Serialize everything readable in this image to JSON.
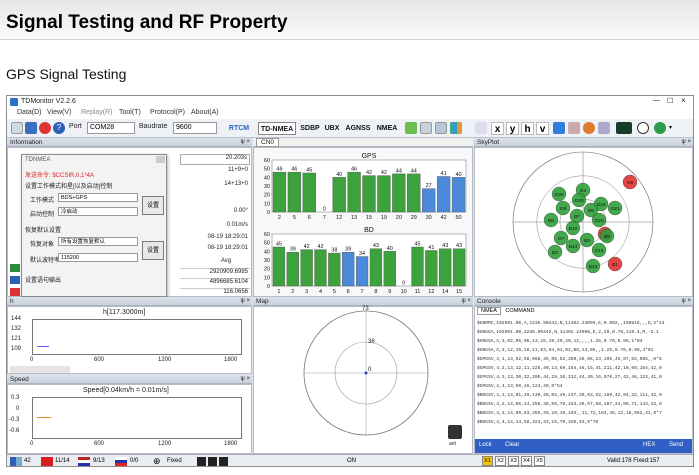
{
  "page": {
    "heading": "Signal Testing and RF Property",
    "subheading": "GPS Signal Testing"
  },
  "app": {
    "title": "TDMonitor V2.2.6",
    "menu": [
      "Data(D)",
      "View(V)",
      "Replay(R)",
      "Tool(T)",
      "Protocol(P)",
      "About(A)"
    ],
    "toolbar": {
      "port_label": "Port",
      "port_value": "COM28",
      "baud_label": "Baudrate",
      "baud_value": "9600",
      "tabs": [
        "RTCM Data",
        "TD-NMEA",
        "SDBP",
        "UBX",
        "AGNSS",
        "NMEA"
      ],
      "letters": [
        "x",
        "y",
        "h",
        "v"
      ]
    }
  },
  "information": {
    "title": "Information",
    "rows": [
      "20.203s",
      "11+9+0",
      "14+13+0",
      "0.00°",
      "0.01m/s",
      "08-19 18:29:01",
      "08-19 18:29:01"
    ],
    "avg_label": "Avg",
    "avg_values": [
      "2920909.6985",
      "4896685.6104",
      "116.0656"
    ]
  },
  "dialog": {
    "title": "TDNMEA",
    "red_line": "发送命令: $CCSIR,0,1*4A",
    "section1": "设置工作模式和星[以及启动]控制",
    "work_mode_label": "工作模式",
    "work_mode_value": "BDS+GPS",
    "start_label": "启动控制",
    "start_value": "冷启动",
    "set_btn": "设置",
    "section2": "恢复默认设置",
    "restore_label": "恢复对象",
    "restore_value": "所有设置恢复默认",
    "baud_label": "默认波特率",
    "baud_value": "115200",
    "set_btn2": "设置",
    "section3": "设置语句输出"
  },
  "h_panel": {
    "title": "h",
    "chart_title": "h[117.3000m]",
    "yticks": [
      "144",
      "132",
      "121",
      "109"
    ],
    "xticks": [
      "0",
      "600",
      "1200",
      "1800"
    ]
  },
  "speed_panel": {
    "title": "Speed",
    "chart_title": "Speed[0.04km/h = 0.01m/s]",
    "yticks": [
      "0.3",
      "0",
      "-0.3",
      "-0.6"
    ],
    "xticks": [
      "0",
      "600",
      "1200",
      "1800"
    ]
  },
  "cn0_panel": {
    "tab": "CN0"
  },
  "map_panel": {
    "title": "Map",
    "scale_top": "73",
    "scale_mid": "36",
    "scale_bottom": "0",
    "icon_label": "ant"
  },
  "skyplot_panel": {
    "title": "SkyPlot",
    "satellites": [
      {
        "id": "G5",
        "color": "#e03030"
      },
      {
        "id": "G2",
        "color": "#2fa03a"
      },
      {
        "id": "G30",
        "color": "#2fa03a"
      },
      {
        "id": "G40",
        "color": "#2fa03a"
      },
      {
        "id": "G29",
        "color": "#2fa03a"
      },
      {
        "id": "G21",
        "color": "#2fa03a"
      },
      {
        "id": "B5",
        "color": "#2fa03a"
      },
      {
        "id": "G8",
        "color": "#2fa03a"
      },
      {
        "id": "B7",
        "color": "#2fa03a"
      },
      {
        "id": "B6",
        "color": "#2fa03a"
      },
      {
        "id": "G20",
        "color": "#2fa03a"
      },
      {
        "id": "B10",
        "color": "#2fa03a"
      },
      {
        "id": "G7",
        "color": "#2fa03a"
      },
      {
        "id": "B9",
        "color": "#e03030"
      },
      {
        "id": "B2",
        "color": "#2fa03a"
      },
      {
        "id": "B14",
        "color": "#2fa03a"
      },
      {
        "id": "B3",
        "color": "#2fa03a"
      },
      {
        "id": "G15",
        "color": "#2fa03a"
      },
      {
        "id": "B1",
        "color": "#e03030"
      },
      {
        "id": "B13",
        "color": "#2fa03a"
      },
      {
        "id": "B8",
        "color": "#2fa03a"
      }
    ]
  },
  "console_panel": {
    "title": "Console",
    "tabs": [
      "NMEA",
      "COMMAND"
    ],
    "lines": [
      "$GNRMC,102901.00,A,2236.90442,N,11402.24096,E,0.002,,190816,,,D,V*14",
      "$GNGGA,102901.00,2236.90442,N,11402.24096,E,2,20,0.76,119.4,M,-2.1",
      "$GNGSA,A,3,02,05,06,13,15,19,29,20,12,,,,1.25,0.76,0.99,1*03",
      "$GNGSA,A,3,12,15,28,11,03,04,01,02,08,14,05,,1.25,0.76,0.99,4*01",
      "$GPGSV,4,1,13,02,58,068,46,05,52,359,46,06,23,105,45,07,02,085,,0*6",
      "$GPGSV,4,2,13,12,11,225,40,13,69,164,46,15,41,211,42,19,09,154,42,0",
      "$GPGSV,4,3,13,20,32,295,44,29,36,312,44,30,16,078,27,42,46,123,41,0",
      "$GPGSV,4,4,13,50,46,123,40,0*54",
      "$BDGSV,4,1,14,01,49,130,45,02,49,237,39,03,62,189,42,04,32,111,42,0",
      "$BDGSV,4,2,14,05,24,256,38,06,70,333,39,07,08,167,34,08,71,143,43,0",
      "$BDGSV,4,3,14,09,63,355,40,10,10,193,,11,72,184,45,12,18,052,41,0*7",
      "$BDGSV,4,4,14,14,58,323,43,15,70,320,43,0*70"
    ],
    "footer_buttons": [
      "Lock",
      "Clear",
      "HEX",
      "Send"
    ]
  },
  "status_bar": {
    "gps_count": "42",
    "cn_count": "11/14",
    "us_count": "9/13",
    "ru_count": "0/0",
    "fix_label": "Fixed",
    "rx_buttons": [
      "X1",
      "X2",
      "X3",
      "X4",
      "X5"
    ],
    "on_label": "ON",
    "valid_text": "Valid:178 Fixed:157"
  },
  "chart_data": [
    {
      "type": "bar",
      "title": "GPS",
      "categories": [
        "2",
        "5",
        "6",
        "7",
        "12",
        "13",
        "15",
        "19",
        "20",
        "29",
        "30",
        "42",
        "50"
      ],
      "values": [
        46,
        46,
        45,
        0,
        40,
        46,
        42,
        42,
        44,
        44,
        27,
        41,
        40
      ],
      "colors": [
        "#3ca23c",
        "#3ca23c",
        "#3ca23c",
        "#3ca23c",
        "#3ca23c",
        "#3ca23c",
        "#3ca23c",
        "#3ca23c",
        "#3ca23c",
        "#3ca23c",
        "#4a8ad8",
        "#4a8ad8",
        "#4a8ad8"
      ],
      "yticks": [
        0,
        10,
        20,
        30,
        40,
        50,
        60
      ],
      "ylim": [
        0,
        60
      ]
    },
    {
      "type": "bar",
      "title": "BD",
      "categories": [
        "1",
        "2",
        "3",
        "4",
        "5",
        "6",
        "7",
        "8",
        "9",
        "10",
        "11",
        "12",
        "14",
        "15"
      ],
      "values": [
        45,
        39,
        42,
        42,
        38,
        39,
        34,
        43,
        40,
        0,
        45,
        41,
        43,
        43
      ],
      "colors": [
        "#3ca23c",
        "#3ca23c",
        "#3ca23c",
        "#3ca23c",
        "#3ca23c",
        "#4a8ad8",
        "#4a8ad8",
        "#3ca23c",
        "#3ca23c",
        "#3ca23c",
        "#3ca23c",
        "#3ca23c",
        "#3ca23c",
        "#3ca23c"
      ],
      "yticks": [
        0,
        10,
        20,
        30,
        40,
        50,
        60
      ],
      "ylim": [
        0,
        60
      ]
    }
  ]
}
